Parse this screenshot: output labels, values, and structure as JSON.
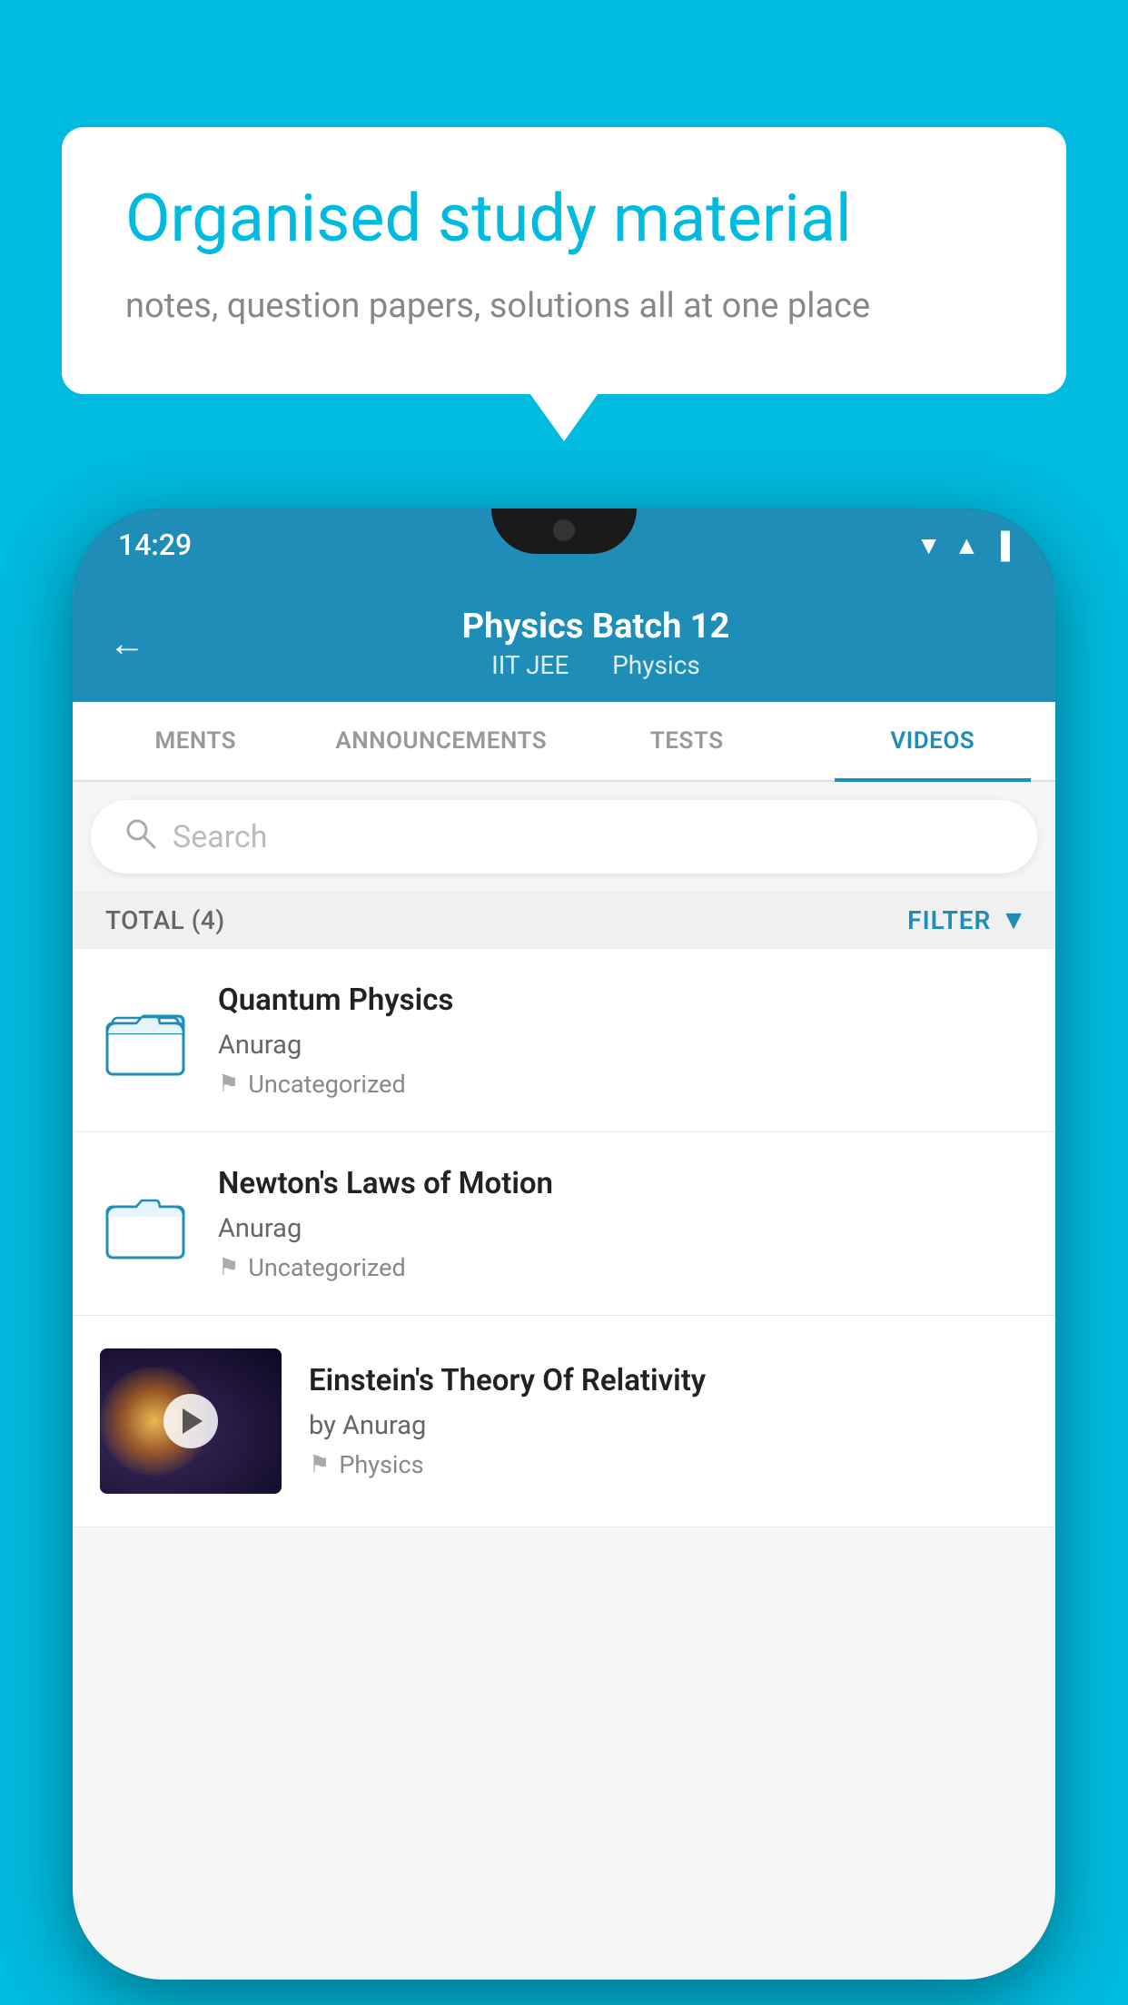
{
  "background_color": "#00BADF",
  "speech_bubble": {
    "headline": "Organised study material",
    "subtext": "notes, question papers, solutions all at one place"
  },
  "phone": {
    "status_bar": {
      "time": "14:29",
      "wifi_icon": "▼",
      "signal_icon": "▲",
      "battery_icon": "▐"
    },
    "header": {
      "back_label": "←",
      "title": "Physics Batch 12",
      "subtitle_part1": "IIT JEE",
      "subtitle_part2": "Physics"
    },
    "tabs": [
      {
        "label": "MENTS",
        "active": false
      },
      {
        "label": "ANNOUNCEMENTS",
        "active": false
      },
      {
        "label": "TESTS",
        "active": false
      },
      {
        "label": "VIDEOS",
        "active": true
      }
    ],
    "search": {
      "placeholder": "Search"
    },
    "filter_row": {
      "total_label": "TOTAL (4)",
      "filter_label": "FILTER"
    },
    "videos": [
      {
        "id": "quantum",
        "type": "folder",
        "title": "Quantum Physics",
        "author": "Anurag",
        "tag": "Uncategorized",
        "has_thumbnail": false
      },
      {
        "id": "newton",
        "type": "folder",
        "title": "Newton's Laws of Motion",
        "author": "Anurag",
        "tag": "Uncategorized",
        "has_thumbnail": false
      },
      {
        "id": "einstein",
        "type": "video",
        "title": "Einstein's Theory Of Relativity",
        "author": "by Anurag",
        "tag": "Physics",
        "has_thumbnail": true
      }
    ]
  }
}
